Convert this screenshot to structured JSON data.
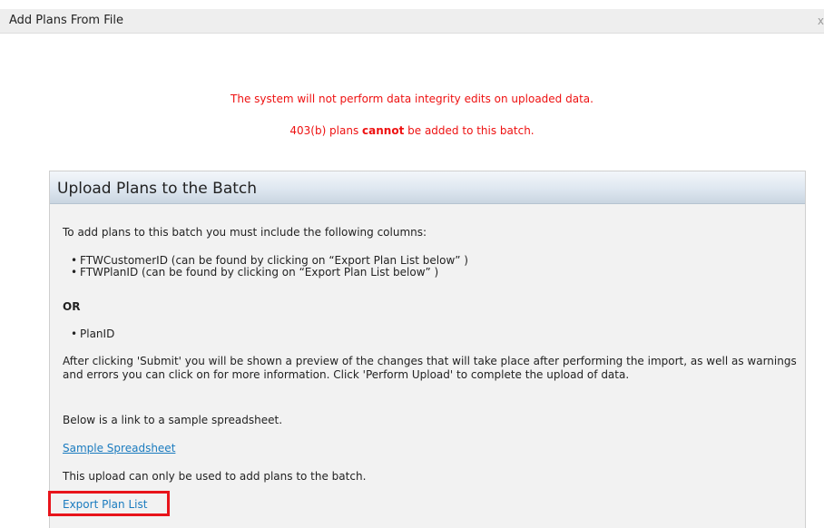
{
  "dialog": {
    "title": "Add Plans From File",
    "close_label": "x"
  },
  "warnings": {
    "line1": "The system will not perform data integrity edits on uploaded data.",
    "line2_prefix": "403(b) plans ",
    "line2_bold": "cannot",
    "line2_suffix": " be added to this batch."
  },
  "panel": {
    "title": "Upload Plans to the Batch",
    "intro": "To add plans to this batch you must include the following columns:",
    "required_columns": [
      "FTWCustomerID (can be found by clicking on “Export Plan List below” )",
      "FTWPlanID (can be found by clicking on “Export Plan List below” )"
    ],
    "or_label": "OR",
    "alt_columns": [
      "PlanID"
    ],
    "submit_info": "After clicking 'Submit' you will be shown a preview of the changes that will take place after performing the import, as well as warnings and errors you can click on for more information. Click 'Perform Upload' to complete the upload of data.",
    "sample_intro": "Below is a link to a sample spreadsheet.",
    "sample_link": "Sample Spreadsheet",
    "upload_note": "This upload can only be used to add plans to the batch.",
    "export_link": "Export Plan List"
  },
  "colors": {
    "warning_text": "#ee1111",
    "link": "#1a7bbf",
    "highlight": "#e8141b"
  }
}
